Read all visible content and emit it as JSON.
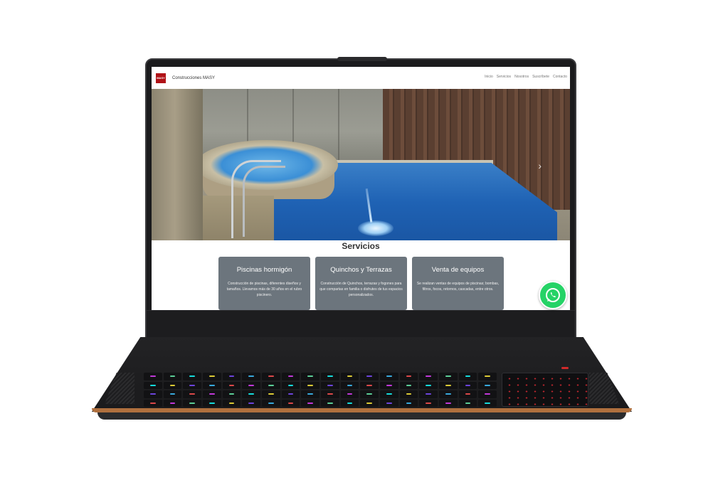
{
  "site": {
    "logo_text": "MASY",
    "brand": "Construcciones MASY",
    "nav": [
      "Inicio",
      "Servicios",
      "Nosotros",
      "Suscríbete",
      "Contacto"
    ]
  },
  "hero": {
    "next_icon": "chevron-right-icon",
    "next_glyph": "›"
  },
  "services": {
    "title": "Servicios",
    "cards": [
      {
        "title": "Piscinas hormigón",
        "text": "Construcción de piscinas, diferentes diseños y tamaños. Llevamos más de 30 años en el rubro piscinero."
      },
      {
        "title": "Quinchos y Terrazas",
        "text": "Construcción de Quinchos, terrazas y fogones para que compartas en familia o disfrutes de tus espacios personalizados."
      },
      {
        "title": "Venta de equipos",
        "text": "Se realizan ventas de equipos de piscinas; bombas, filtros, focos, retornos, cascadas, entre otros."
      }
    ]
  },
  "whatsapp": {
    "icon": "whatsapp-icon",
    "color": "#25d366"
  },
  "colors": {
    "logo_bg": "#b01217",
    "card_bg": "#6c757d",
    "laptop_trim": "#b0703e"
  }
}
